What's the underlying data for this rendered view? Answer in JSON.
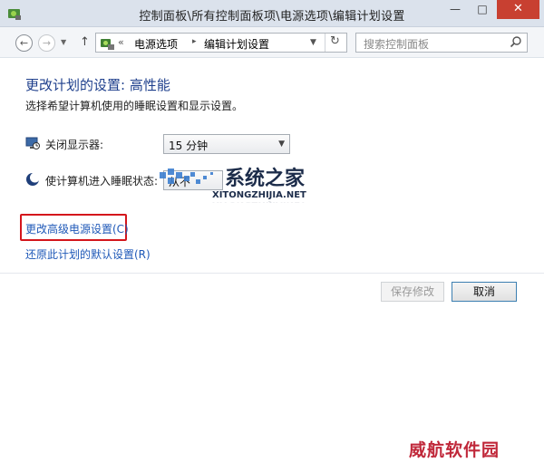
{
  "window": {
    "title": "控制面板\\所有控制面板项\\电源选项\\编辑计划设置",
    "minimize_glyph": "—",
    "maximize_glyph": "□",
    "close_glyph": "✕"
  },
  "nav": {
    "back_glyph": "←",
    "forward_glyph": "→",
    "up_glyph": "↑",
    "address_prefix": "«",
    "crumbs": [
      "电源选项",
      "编辑计划设置"
    ],
    "crumb_separator": "▸",
    "refresh_glyph": "↻",
    "search_placeholder": "搜索控制面板"
  },
  "content": {
    "title": "更改计划的设置: 高性能",
    "subtitle": "选择希望计算机使用的睡眠设置和显示设置。",
    "display_off_label": "关闭显示器:",
    "display_off_value": "15 分钟",
    "sleep_label": "使计算机进入睡眠状态:",
    "sleep_value": "从不",
    "advanced_link": "更改高级电源设置(C)",
    "restore_link": "还原此计划的默认设置(R)"
  },
  "buttons": {
    "save": "保存修改",
    "cancel": "取消"
  },
  "watermark": {
    "brand": "系统之家",
    "domain": "XITONGZHIJIA.NET",
    "bottom_mark": "威航软件园"
  },
  "colors": {
    "title_blue": "#1e3f8c",
    "link_blue": "#1f59b8",
    "highlight_red": "#d4161c",
    "close_red": "#c84031"
  }
}
